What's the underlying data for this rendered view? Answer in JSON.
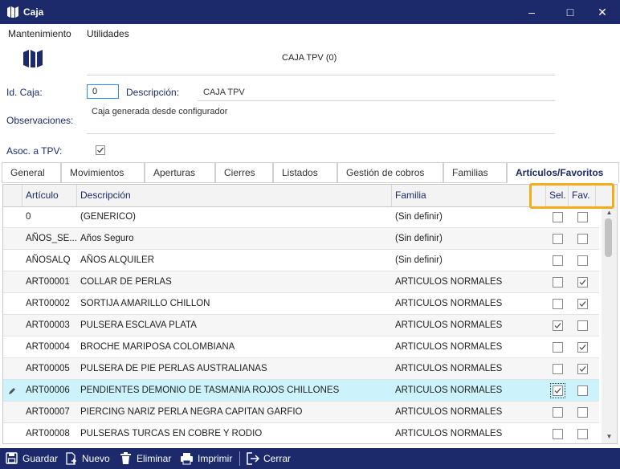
{
  "window": {
    "title": "Caja"
  },
  "menu": {
    "items": [
      "Mantenimiento",
      "Utilidades"
    ]
  },
  "header": {
    "title": "CAJA TPV (0)"
  },
  "form": {
    "id_caja_label": "Id. Caja:",
    "id_caja_value": "0",
    "descripcion_label": "Descripción:",
    "descripcion_value": "CAJA TPV",
    "observaciones_label": "Observaciones:",
    "observaciones_value": "Caja generada desde configurador",
    "asoc_tpv_label": "Asoc. a TPV:",
    "asoc_tpv_checked": true
  },
  "tabs": [
    {
      "label": "General",
      "active": false
    },
    {
      "label": "Movimientos",
      "active": false
    },
    {
      "label": "Aperturas",
      "active": false
    },
    {
      "label": "Cierres",
      "active": false
    },
    {
      "label": "Listados",
      "active": false
    },
    {
      "label": "Gestión de cobros",
      "active": false
    },
    {
      "label": "Familias",
      "active": false
    },
    {
      "label": "Artículos/Favoritos",
      "active": true
    }
  ],
  "grid": {
    "columns": [
      "Artículo",
      "Descripción",
      "Familia",
      "Sel.",
      "Fav."
    ],
    "rows": [
      {
        "articulo": "0",
        "descripcion": "(GENERICO)",
        "familia": "(Sin definir)",
        "sel": false,
        "fav": false
      },
      {
        "articulo": "AÑOS_SE...",
        "descripcion": "Años Seguro",
        "familia": "(Sin definir)",
        "sel": false,
        "fav": false
      },
      {
        "articulo": "AÑOSALQ",
        "descripcion": "AÑOS ALQUILER",
        "familia": "(Sin definir)",
        "sel": false,
        "fav": false
      },
      {
        "articulo": "ART00001",
        "descripcion": "COLLAR DE PERLAS",
        "familia": "ARTICULOS NORMALES",
        "sel": false,
        "fav": true
      },
      {
        "articulo": "ART00002",
        "descripcion": "SORTIJA AMARILLO CHILLON",
        "familia": "ARTICULOS NORMALES",
        "sel": false,
        "fav": true
      },
      {
        "articulo": "ART00003",
        "descripcion": "PULSERA ESCLAVA PLATA",
        "familia": "ARTICULOS NORMALES",
        "sel": true,
        "fav": false
      },
      {
        "articulo": "ART00004",
        "descripcion": "BROCHE MARIPOSA COLOMBIANA",
        "familia": "ARTICULOS NORMALES",
        "sel": false,
        "fav": true
      },
      {
        "articulo": "ART00005",
        "descripcion": "PULSERA DE PIE PERLAS AUSTRALIANAS",
        "familia": "ARTICULOS NORMALES",
        "sel": false,
        "fav": true
      },
      {
        "articulo": "ART00006",
        "descripcion": "PENDIENTES DEMONIO DE TASMANIA ROJOS CHILLONES",
        "familia": "ARTICULOS NORMALES",
        "sel": true,
        "fav": false,
        "selected_row": true
      },
      {
        "articulo": "ART00007",
        "descripcion": "PIERCING NARIZ PERLA NEGRA CAPITAN GARFIO",
        "familia": "ARTICULOS NORMALES",
        "sel": false,
        "fav": false
      },
      {
        "articulo": "ART00008",
        "descripcion": "PULSERAS TURCAS EN COBRE Y RODIO",
        "familia": "ARTICULOS NORMALES",
        "sel": false,
        "fav": false
      }
    ]
  },
  "toolbar": {
    "guardar": "Guardar",
    "nuevo": "Nuevo",
    "eliminar": "Eliminar",
    "imprimir": "Imprimir",
    "cerrar": "Cerrar"
  },
  "colors": {
    "brand": "#1c2a6b",
    "highlight": "#f5ac1a",
    "selected_row": "#ccf3fb"
  }
}
